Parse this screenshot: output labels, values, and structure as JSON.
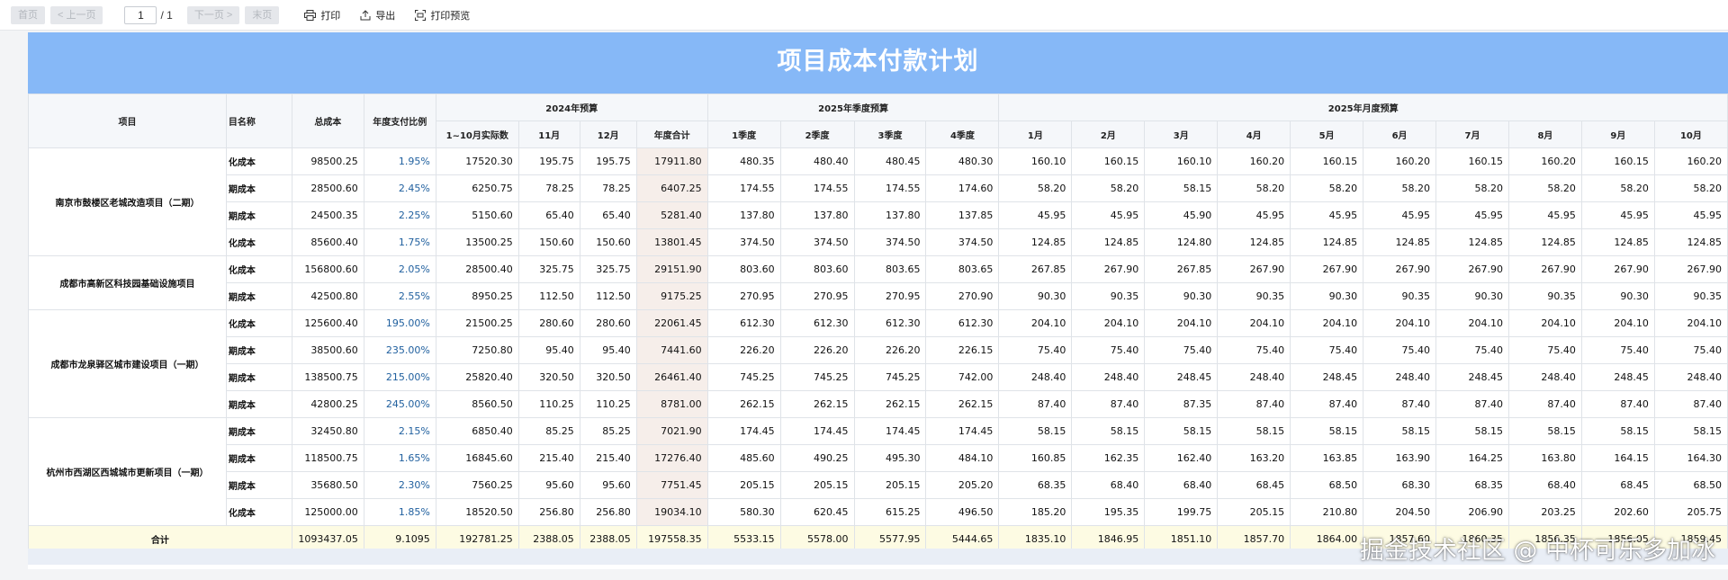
{
  "toolbar": {
    "first_page": "首页",
    "prev_page": "< 上一页",
    "page_value": "1",
    "page_total": "/ 1",
    "next_page": "下一页 >",
    "last_page": "末页",
    "print": "打印",
    "export": "导出",
    "print_preview": "打印预览"
  },
  "report": {
    "title": "项目成本付款计划",
    "headers": {
      "project": "项目",
      "item_name": "目名称",
      "total_cost": "总成本",
      "annual_ratio": "年度支付比例",
      "group_2024": "2024年预算",
      "group_2025q": "2025年季度预算",
      "group_2025m": "2025年月度预算",
      "sub_cols": [
        "1~10月实际数",
        "11月",
        "12月",
        "年度合计",
        "1季度",
        "2季度",
        "3季度",
        "4季度",
        "1月",
        "2月",
        "3月",
        "4月",
        "5月",
        "6月",
        "7月",
        "8月",
        "9月",
        "10月"
      ]
    },
    "projects": [
      {
        "name": "南京市鼓楼区老城改造项目（二期）",
        "rows": [
          {
            "item": "化成本",
            "total": "98500.25",
            "ratio": "1.95%",
            "v": [
              "17520.30",
              "195.75",
              "195.75",
              "17911.80",
              "480.35",
              "480.40",
              "480.45",
              "480.30",
              "160.10",
              "160.15",
              "160.10",
              "160.20",
              "160.15",
              "160.20",
              "160.15",
              "160.20",
              "160.15",
              "160.20"
            ]
          },
          {
            "item": "期成本",
            "total": "28500.60",
            "ratio": "2.45%",
            "v": [
              "6250.75",
              "78.25",
              "78.25",
              "6407.25",
              "174.55",
              "174.55",
              "174.55",
              "174.60",
              "58.20",
              "58.20",
              "58.15",
              "58.20",
              "58.20",
              "58.20",
              "58.20",
              "58.20",
              "58.20",
              "58.20"
            ]
          },
          {
            "item": "期成本",
            "total": "24500.35",
            "ratio": "2.25%",
            "v": [
              "5150.60",
              "65.40",
              "65.40",
              "5281.40",
              "137.80",
              "137.80",
              "137.80",
              "137.85",
              "45.95",
              "45.95",
              "45.90",
              "45.95",
              "45.95",
              "45.95",
              "45.95",
              "45.95",
              "45.95",
              "45.95"
            ]
          },
          {
            "item": "化成本",
            "total": "85600.40",
            "ratio": "1.75%",
            "v": [
              "13500.25",
              "150.60",
              "150.60",
              "13801.45",
              "374.50",
              "374.50",
              "374.50",
              "374.50",
              "124.85",
              "124.85",
              "124.80",
              "124.85",
              "124.85",
              "124.85",
              "124.85",
              "124.85",
              "124.85",
              "124.85"
            ]
          }
        ]
      },
      {
        "name": "成都市高新区科技园基础设施项目",
        "rows": [
          {
            "item": "化成本",
            "total": "156800.60",
            "ratio": "2.05%",
            "v": [
              "28500.40",
              "325.75",
              "325.75",
              "29151.90",
              "803.60",
              "803.60",
              "803.65",
              "803.65",
              "267.85",
              "267.90",
              "267.85",
              "267.90",
              "267.90",
              "267.90",
              "267.90",
              "267.90",
              "267.90",
              "267.90"
            ]
          },
          {
            "item": "期成本",
            "total": "42500.80",
            "ratio": "2.55%",
            "v": [
              "8950.25",
              "112.50",
              "112.50",
              "9175.25",
              "270.95",
              "270.95",
              "270.95",
              "270.90",
              "90.30",
              "90.35",
              "90.30",
              "90.35",
              "90.30",
              "90.35",
              "90.30",
              "90.35",
              "90.30",
              "90.35"
            ]
          }
        ]
      },
      {
        "name": "成都市龙泉驿区城市建设项目（一期）",
        "rows": [
          {
            "item": "化成本",
            "total": "125600.40",
            "ratio": "195.00%",
            "v": [
              "21500.25",
              "280.60",
              "280.60",
              "22061.45",
              "612.30",
              "612.30",
              "612.30",
              "612.30",
              "204.10",
              "204.10",
              "204.10",
              "204.10",
              "204.10",
              "204.10",
              "204.10",
              "204.10",
              "204.10",
              "204.10"
            ]
          },
          {
            "item": "期成本",
            "total": "38500.60",
            "ratio": "235.00%",
            "v": [
              "7250.80",
              "95.40",
              "95.40",
              "7441.60",
              "226.20",
              "226.20",
              "226.20",
              "226.15",
              "75.40",
              "75.40",
              "75.40",
              "75.40",
              "75.40",
              "75.40",
              "75.40",
              "75.40",
              "75.40",
              "75.40"
            ]
          },
          {
            "item": "期成本",
            "total": "138500.75",
            "ratio": "215.00%",
            "v": [
              "25820.40",
              "320.50",
              "320.50",
              "26461.40",
              "745.25",
              "745.25",
              "745.25",
              "742.00",
              "248.40",
              "248.40",
              "248.45",
              "248.40",
              "248.45",
              "248.40",
              "248.45",
              "248.40",
              "248.45",
              "248.40"
            ]
          },
          {
            "item": "期成本",
            "total": "42800.25",
            "ratio": "245.00%",
            "v": [
              "8560.50",
              "110.25",
              "110.25",
              "8781.00",
              "262.15",
              "262.15",
              "262.15",
              "262.15",
              "87.40",
              "87.40",
              "87.35",
              "87.40",
              "87.40",
              "87.40",
              "87.40",
              "87.40",
              "87.40",
              "87.40"
            ]
          }
        ]
      },
      {
        "name": "杭州市西湖区西城城市更新项目（一期）",
        "rows": [
          {
            "item": "期成本",
            "total": "32450.80",
            "ratio": "2.15%",
            "v": [
              "6850.40",
              "85.25",
              "85.25",
              "7021.90",
              "174.45",
              "174.45",
              "174.45",
              "174.45",
              "58.15",
              "58.15",
              "58.15",
              "58.15",
              "58.15",
              "58.15",
              "58.15",
              "58.15",
              "58.15",
              "58.15"
            ]
          },
          {
            "item": "期成本",
            "total": "118500.75",
            "ratio": "1.65%",
            "v": [
              "16845.60",
              "215.40",
              "215.40",
              "17276.40",
              "485.60",
              "490.25",
              "495.30",
              "484.10",
              "160.85",
              "162.35",
              "162.40",
              "163.20",
              "163.85",
              "163.90",
              "164.25",
              "163.80",
              "164.15",
              "164.30"
            ]
          },
          {
            "item": "期成本",
            "total": "35680.50",
            "ratio": "2.30%",
            "v": [
              "7560.25",
              "95.60",
              "95.60",
              "7751.45",
              "205.15",
              "205.15",
              "205.15",
              "205.20",
              "68.35",
              "68.40",
              "68.40",
              "68.45",
              "68.50",
              "68.30",
              "68.35",
              "68.40",
              "68.45",
              "68.50"
            ]
          },
          {
            "item": "化成本",
            "total": "125000.00",
            "ratio": "1.85%",
            "v": [
              "18520.50",
              "256.80",
              "256.80",
              "19034.10",
              "580.30",
              "620.45",
              "615.25",
              "496.50",
              "185.20",
              "195.35",
              "199.75",
              "205.15",
              "210.80",
              "204.50",
              "206.90",
              "203.25",
              "202.60",
              "205.75"
            ]
          }
        ]
      }
    ],
    "totals": {
      "label": "合计",
      "total": "1093437.05",
      "ratio": "9.1095",
      "v": [
        "192781.25",
        "2388.05",
        "2388.05",
        "197558.35",
        "5533.15",
        "5578.00",
        "5577.95",
        "5444.65",
        "1835.10",
        "1846.95",
        "1851.10",
        "1857.70",
        "1864.00",
        "1857.60",
        "1860.35",
        "1856.35",
        "1856.05",
        "1859.45"
      ]
    }
  },
  "watermark": "掘金技术社区 @ 中杯可乐多加冰",
  "colors": {
    "title_bar": "#86b8f7",
    "ratio_text": "#1f5f9e",
    "totals_row": "#fdfbe3",
    "annual_col": "#f6eeea"
  }
}
